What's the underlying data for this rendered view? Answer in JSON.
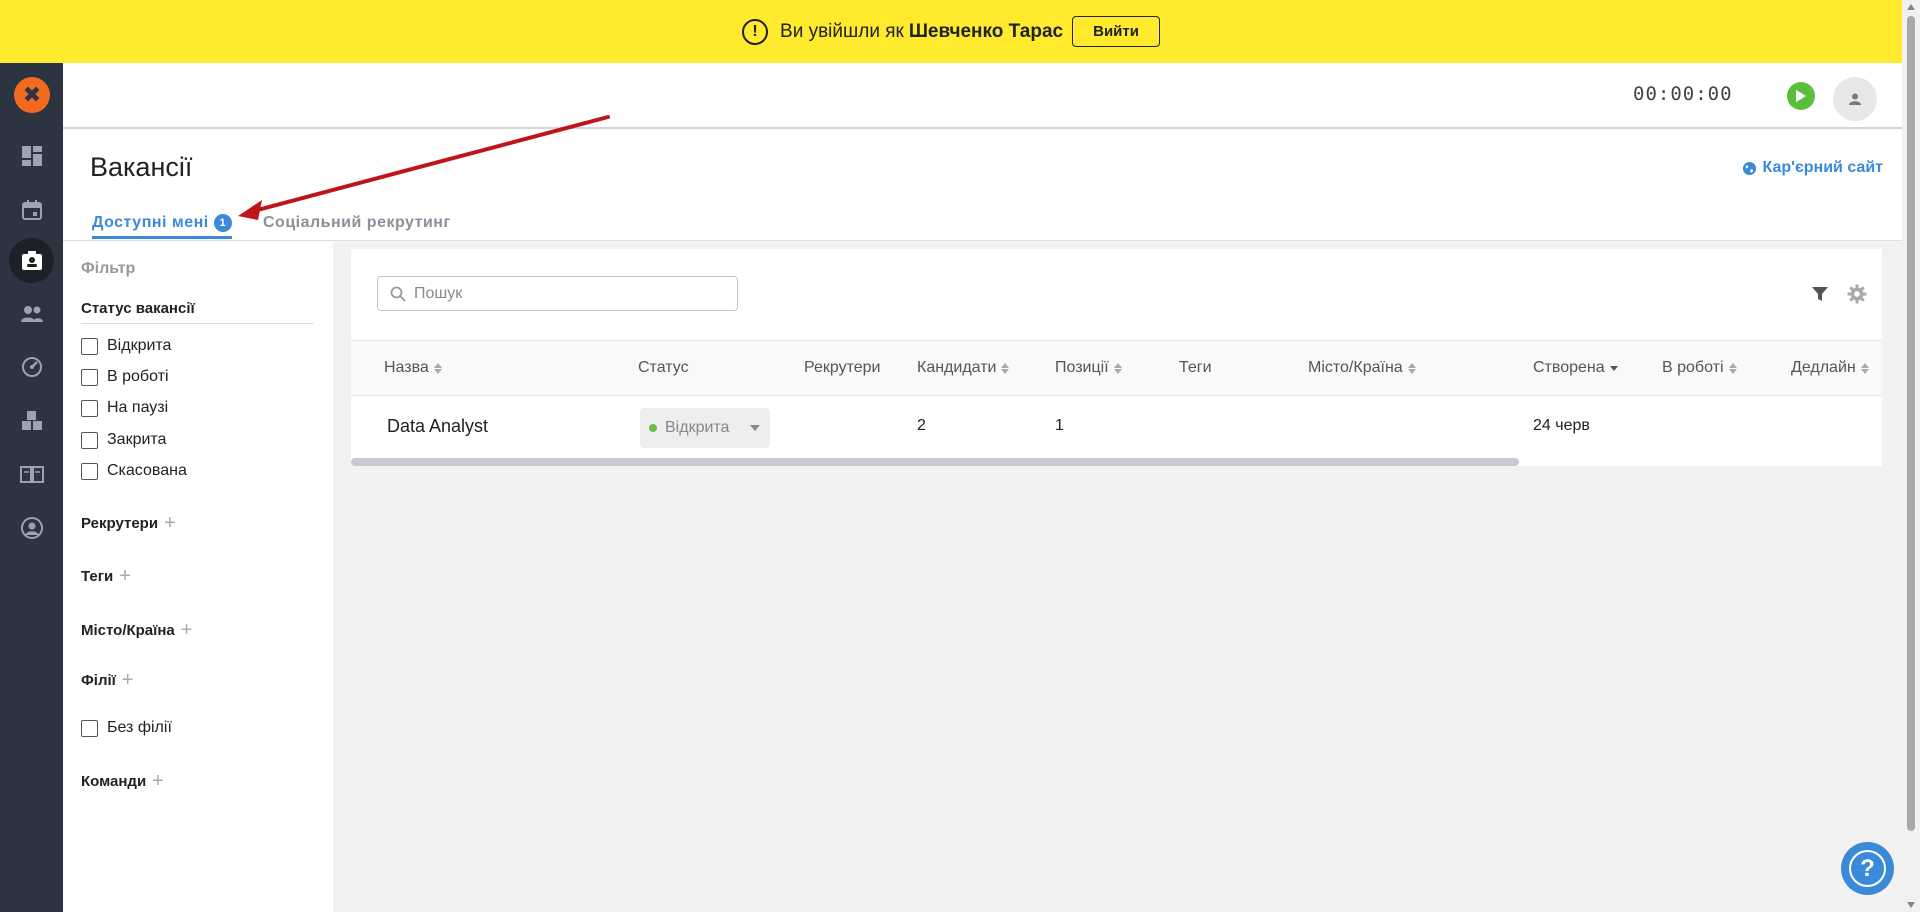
{
  "banner": {
    "message": "Ви увійшли як",
    "user_name": "Шевченко Тарас",
    "logout_label": "Вийти"
  },
  "header": {
    "timer": "00:00:00"
  },
  "page": {
    "title": "Вакансії",
    "career_link": "Кар'єрний сайт"
  },
  "tabs": [
    {
      "label": "Доступні мені",
      "badge": "1"
    },
    {
      "label": "Соціальний рекрутинг"
    }
  ],
  "filters": {
    "title": "Фільтр",
    "status_title": "Статус вакансії",
    "statuses": [
      "Відкрита",
      "В роботі",
      "На паузі",
      "Закрита",
      "Скасована"
    ],
    "recruiters": "Рекрутери",
    "tags": "Теги",
    "city": "Місто/Країна",
    "branches": "Філії",
    "no_branch": "Без філії",
    "teams": "Команди"
  },
  "search": {
    "placeholder": "Пошук"
  },
  "table": {
    "columns": [
      "Назва",
      "Статус",
      "Рекрутери",
      "Кандидати",
      "Позиції",
      "Теги",
      "Місто/Країна",
      "Створена",
      "В роботі",
      "Дедлайн"
    ],
    "rows": [
      {
        "name": "Data Analyst",
        "status": "Відкрита",
        "candidates": "2",
        "positions": "1",
        "created": "24 черв"
      }
    ]
  },
  "colors": {
    "banner": "#ffea2e",
    "sidebar": "#2c3441",
    "accent": "#3b8ad9",
    "logo": "#f26a21",
    "play": "#5cbf3b",
    "annotation_arrow": "#c0141b"
  }
}
